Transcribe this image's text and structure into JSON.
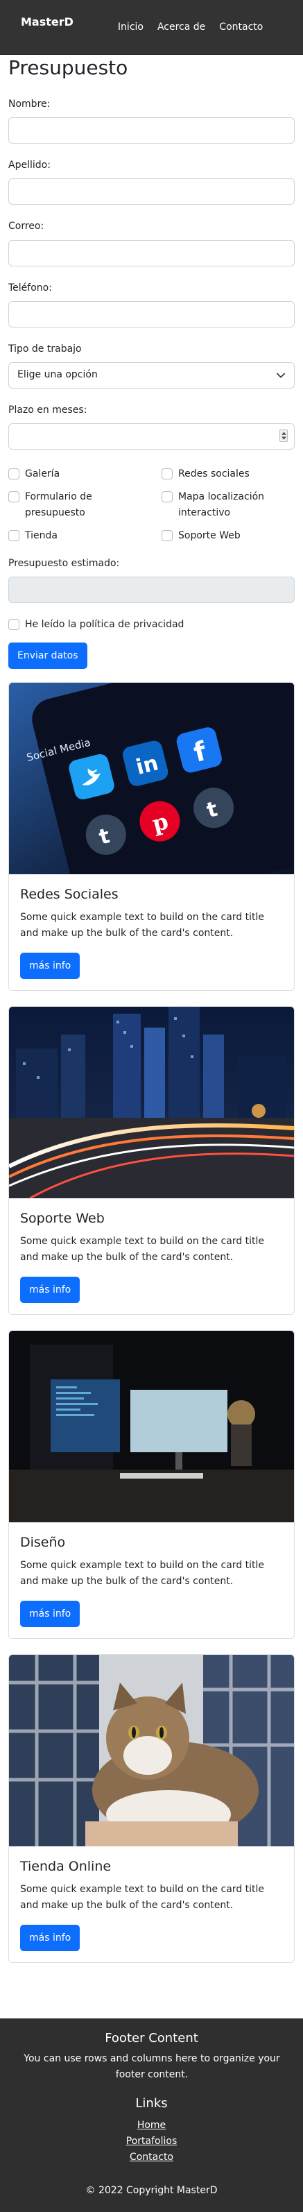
{
  "navbar": {
    "brand": "MasterD",
    "links": [
      "Inicio",
      "Acerca de",
      "Contacto"
    ]
  },
  "form": {
    "title": "Presupuesto",
    "fields": {
      "nombre": {
        "label": "Nombre:",
        "value": ""
      },
      "apellido": {
        "label": "Apellido:",
        "value": ""
      },
      "correo": {
        "label": "Correo:",
        "value": ""
      },
      "telefono": {
        "label": "Teléfono:",
        "value": ""
      }
    },
    "tipo": {
      "label": "Tipo de trabajo",
      "selected": "Elige una opción"
    },
    "plazo": {
      "label": "Plazo en meses:",
      "value": ""
    },
    "checks": [
      {
        "label": "Galería",
        "checked": false
      },
      {
        "label": "Redes sociales",
        "checked": false
      },
      {
        "label": "Formulario de presupuesto",
        "checked": false
      },
      {
        "label": "Mapa localización interactivo",
        "checked": false
      },
      {
        "label": "Tienda",
        "checked": false
      },
      {
        "label": "Soporte Web",
        "checked": false
      }
    ],
    "estimate": {
      "label": "Presupuesto estimado:",
      "value": ""
    },
    "privacy": {
      "label": "He leído la política de privacidad",
      "checked": false
    },
    "submit": "Enviar datos"
  },
  "cards": [
    {
      "title": "Redes Sociales",
      "text": "Some quick example text to build on the card title and make up the bulk of the card's content.",
      "button": "más info",
      "image": "social-media-app-icons-photo"
    },
    {
      "title": "Soporte Web",
      "text": "Some quick example text to build on the card title and make up the bulk of the card's content.",
      "button": "más info",
      "image": "city-night-traffic-photo"
    },
    {
      "title": "Diseño",
      "text": "Some quick example text to build on the card title and make up the bulk of the card's content.",
      "button": "más info",
      "image": "dark-desk-computer-setup-photo"
    },
    {
      "title": "Tienda Online",
      "text": "Some quick example text to build on the card title and make up the bulk of the card's content.",
      "button": "más info",
      "image": "cat-in-arms-photo"
    }
  ],
  "footer": {
    "title": "Footer Content",
    "text": "You can use rows and columns here to organize your footer content.",
    "links_title": "Links",
    "links": [
      "Home",
      "Portafolios",
      "Contacto"
    ],
    "copyright": "© 2022 Copyright MasterD"
  },
  "colors": {
    "navbar_bg": "#333333",
    "primary": "#0d6efd",
    "footer_bg": "#2f2f2f",
    "readonly_bg": "#e9ecef"
  }
}
